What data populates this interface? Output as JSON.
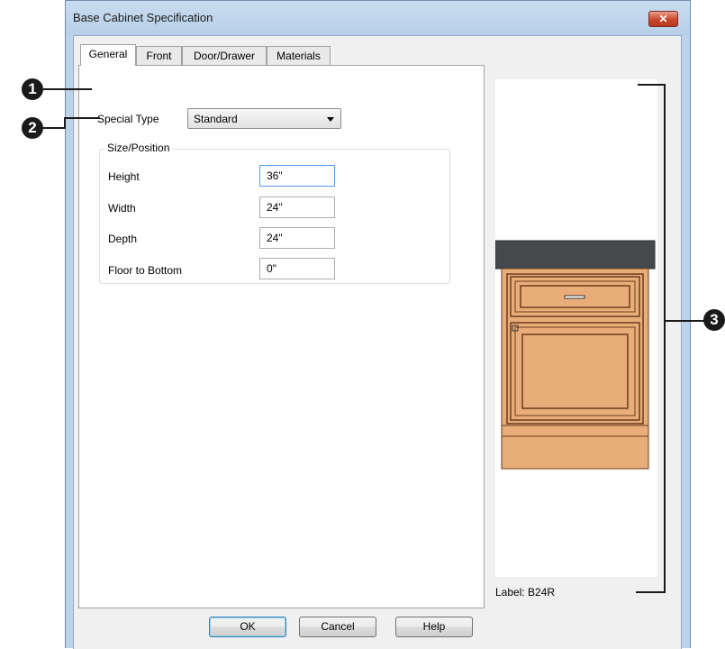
{
  "window": {
    "title": "Base Cabinet Specification",
    "close_glyph": "✕"
  },
  "tabs": [
    {
      "label": "General",
      "active": true
    },
    {
      "label": "Front",
      "active": false
    },
    {
      "label": "Door/Drawer",
      "active": false
    },
    {
      "label": "Materials",
      "active": false
    }
  ],
  "general": {
    "special_type_label": "Special Type",
    "special_type_value": "Standard",
    "size_position": {
      "title": "Size/Position",
      "fields": [
        {
          "label": "Height",
          "value": "36\""
        },
        {
          "label": "Width",
          "value": "24\""
        },
        {
          "label": "Depth",
          "value": "24\""
        },
        {
          "label": "Floor to Bottom",
          "value": "0\""
        }
      ]
    }
  },
  "preview": {
    "label": "Label:  B24R"
  },
  "buttons": {
    "ok": "OK",
    "cancel": "Cancel",
    "help": "Help"
  },
  "callouts": [
    "1",
    "2",
    "3"
  ],
  "colors": {
    "countertop": "#46494c",
    "cabinet_wood": "#e8ad78",
    "cabinet_outline": "#6b3d1f",
    "title_bar": "#c1d6ed",
    "close_button": "#c8462c"
  }
}
